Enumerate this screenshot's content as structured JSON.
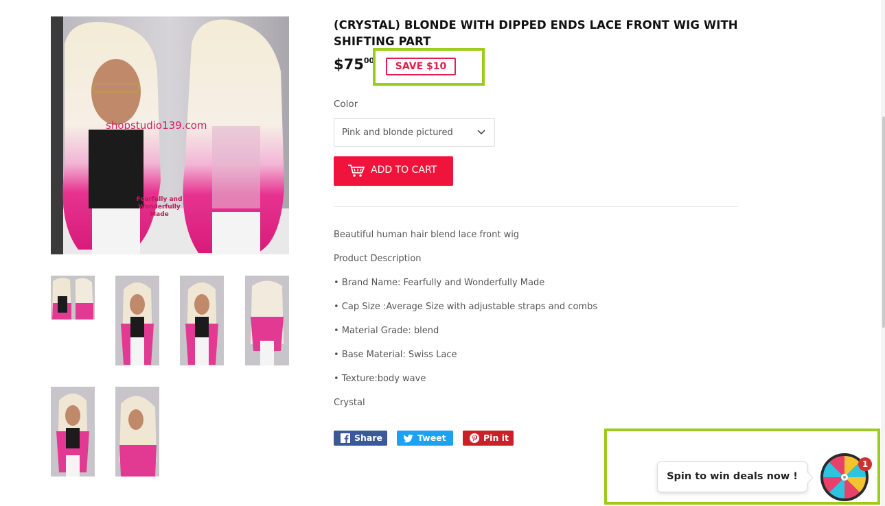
{
  "product": {
    "title": "(CRYSTAL) BLONDE WITH DIPPED ENDS LACE FRONT WIG WITH SHIFTING PART",
    "price_main": "$75",
    "price_cents": "00",
    "save_badge": "SAVE $10",
    "color_label": "Color",
    "color_selected": "Pink and blonde pictured",
    "add_to_cart": "ADD TO CART",
    "image_watermark": "shopstudio139.com",
    "image_watermark2": "Fearfully and Wonderfully Made"
  },
  "description": [
    "Beautiful human hair blend lace front wig",
    "Product Description",
    "• Brand Name: Fearfully and Wonderfully Made",
    "• Cap Size :Average Size with adjustable straps and combs",
    "• Material Grade: blend",
    "• Base Material: Swiss Lace",
    "• Texture:body wave",
    "Crystal"
  ],
  "share": {
    "facebook": "Share",
    "twitter": "Tweet",
    "pinterest": "Pin it"
  },
  "spin_widget": {
    "label": "Spin to win deals now !",
    "badge_count": "1"
  },
  "colors": {
    "accent": "#f0143c",
    "highlight": "#9acd1a",
    "facebook": "#3b5998",
    "twitter": "#1da1f2",
    "pinterest": "#cb2027"
  }
}
